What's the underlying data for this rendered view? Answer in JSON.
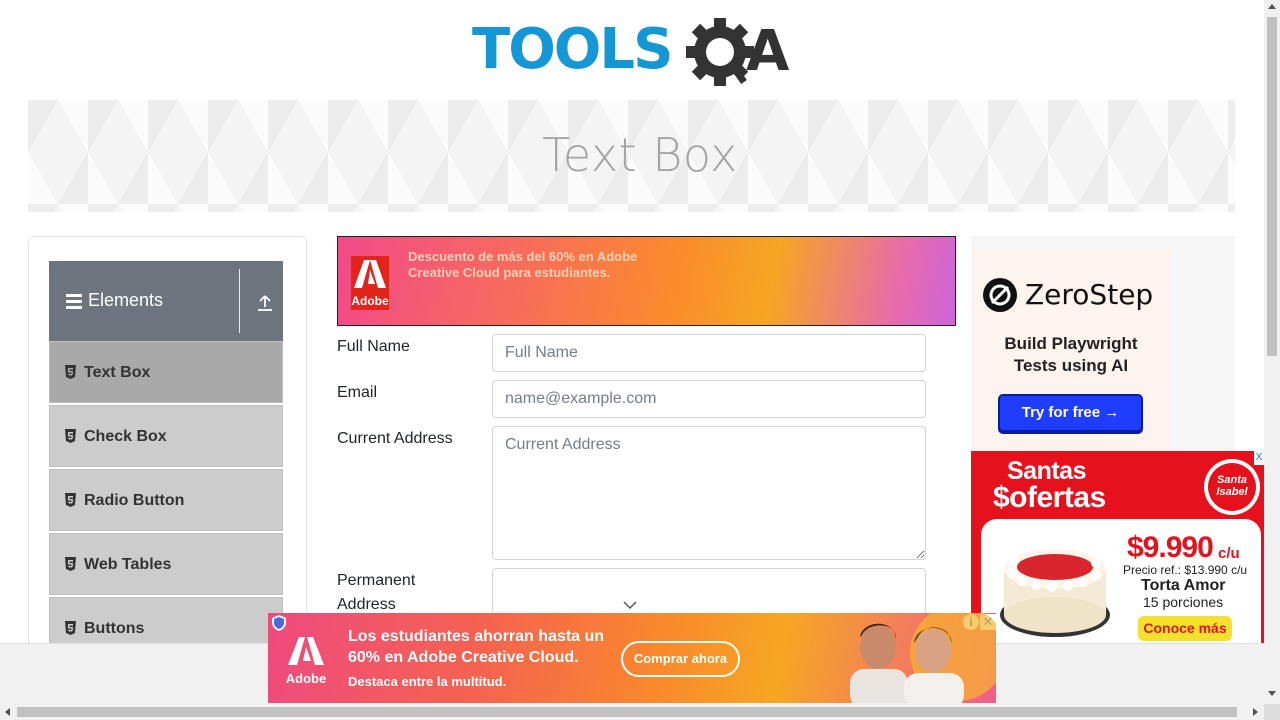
{
  "logo": {
    "text_part1": "TOOLS",
    "text_part2": "A",
    "colors": {
      "primary": "#1597d5",
      "secondary": "#333333"
    }
  },
  "page_title": "Text Box",
  "sidebar": {
    "group_title": "Elements",
    "items": [
      {
        "label": "Text Box",
        "active": true
      },
      {
        "label": "Check Box",
        "active": false
      },
      {
        "label": "Radio Button",
        "active": false
      },
      {
        "label": "Web Tables",
        "active": false
      },
      {
        "label": "Buttons",
        "active": false
      }
    ]
  },
  "top_ad": {
    "brand": "Adobe",
    "text": "Descuento de más del 60% en Adobe Creative Cloud para estudiantes."
  },
  "form": {
    "full_name": {
      "label": "Full Name",
      "placeholder": "Full Name",
      "value": ""
    },
    "email": {
      "label": "Email",
      "placeholder": "name@example.com",
      "value": ""
    },
    "current_address": {
      "label": "Current Address",
      "placeholder": "Current Address",
      "value": ""
    },
    "permanent_address": {
      "label_line1": "Permanent",
      "label_line2": "Address",
      "value": ""
    }
  },
  "zerostep_ad": {
    "brand": "ZeroStep",
    "tagline_line1": "Build Playwright",
    "tagline_line2": "Tests using AI",
    "cta": "Try for free →"
  },
  "santa_ad": {
    "title_line1": "Santas",
    "title_line2": "$ofertas",
    "brand_line1": "Santa",
    "brand_line2": "Isabel",
    "price": "$9.990",
    "price_unit": "c/u",
    "ref_price": "Precio ref.: $13.990 c/u",
    "product": "Torta Amor",
    "portions": "15 porciones",
    "cta": "Conoce más",
    "close": "X"
  },
  "bottom_ad": {
    "brand": "Adobe",
    "headline": "Los estudiantes ahorran hasta un 60% en Adobe Creative Cloud.",
    "sub": "Destaca entre la multitud.",
    "cta": "Comprar ahora",
    "info": "i",
    "close": "✕"
  }
}
